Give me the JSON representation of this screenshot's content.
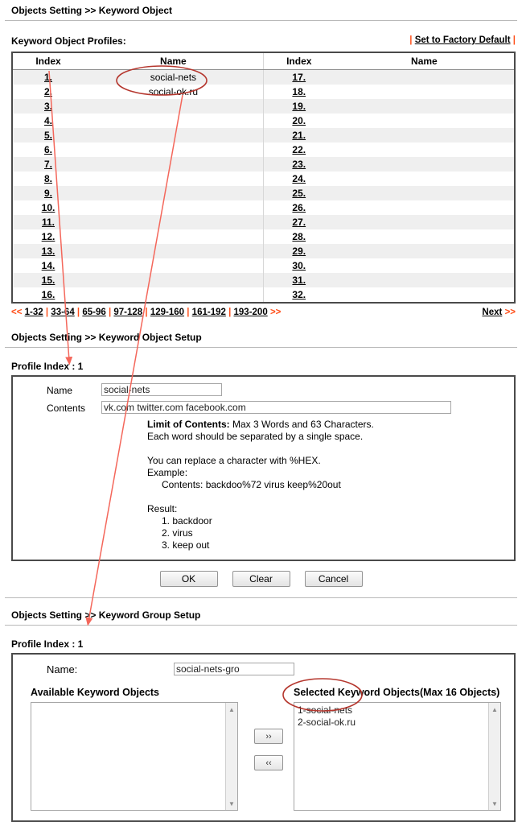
{
  "sections": {
    "keyword_object": {
      "title": "Objects Setting >> Keyword Object",
      "profiles_label": "Keyword Object Profiles:",
      "factory_default": "Set to Factory Default",
      "pipe": "|",
      "columns": [
        "Index",
        "Name",
        "Index",
        "Name"
      ],
      "rows_left": [
        {
          "index": "1.",
          "name": "social-nets"
        },
        {
          "index": "2.",
          "name": "social-ok.ru"
        },
        {
          "index": "3.",
          "name": ""
        },
        {
          "index": "4.",
          "name": ""
        },
        {
          "index": "5.",
          "name": ""
        },
        {
          "index": "6.",
          "name": ""
        },
        {
          "index": "7.",
          "name": ""
        },
        {
          "index": "8.",
          "name": ""
        },
        {
          "index": "9.",
          "name": ""
        },
        {
          "index": "10.",
          "name": ""
        },
        {
          "index": "11.",
          "name": ""
        },
        {
          "index": "12.",
          "name": ""
        },
        {
          "index": "13.",
          "name": ""
        },
        {
          "index": "14.",
          "name": ""
        },
        {
          "index": "15.",
          "name": ""
        },
        {
          "index": "16.",
          "name": ""
        }
      ],
      "rows_right": [
        {
          "index": "17.",
          "name": ""
        },
        {
          "index": "18.",
          "name": ""
        },
        {
          "index": "19.",
          "name": ""
        },
        {
          "index": "20.",
          "name": ""
        },
        {
          "index": "21.",
          "name": ""
        },
        {
          "index": "22.",
          "name": ""
        },
        {
          "index": "23.",
          "name": ""
        },
        {
          "index": "24.",
          "name": ""
        },
        {
          "index": "25.",
          "name": ""
        },
        {
          "index": "26.",
          "name": ""
        },
        {
          "index": "27.",
          "name": ""
        },
        {
          "index": "28.",
          "name": ""
        },
        {
          "index": "29.",
          "name": ""
        },
        {
          "index": "30.",
          "name": ""
        },
        {
          "index": "31.",
          "name": ""
        },
        {
          "index": "32.",
          "name": ""
        }
      ],
      "pager": {
        "prev_arrows": "<<",
        "next_arrows": ">>",
        "ranges": [
          "1-32",
          "33-64",
          "65-96",
          "97-128",
          "129-160",
          "161-192",
          "193-200"
        ],
        "separator": "|",
        "next_label": "Next",
        "next_label_arrows": ">>"
      }
    },
    "keyword_object_setup": {
      "title": "Objects Setting >> Keyword Object Setup",
      "profile_index": "Profile Index : 1",
      "name_label": "Name",
      "name_value": "social-nets",
      "contents_label": "Contents",
      "contents_value": "vk.com twitter.com facebook.com",
      "help": {
        "limit_bold": "Limit of Contents:",
        "limit_rest": " Max 3 Words and 63 Characters.",
        "line2": "Each word should be separated by a single space.",
        "line3": "You can replace a character with %HEX.",
        "line4": "Example:",
        "line5": "Contents: backdoo%72 virus keep%20out",
        "line6": "Result:",
        "line7": "1. backdoor",
        "line8": "2. virus",
        "line9": "3. keep out"
      },
      "buttons": {
        "ok": "OK",
        "clear": "Clear",
        "cancel": "Cancel"
      }
    },
    "keyword_group_setup": {
      "title": "Objects Setting >> Keyword Group Setup",
      "profile_index": "Profile Index : 1",
      "name_label": "Name:",
      "name_value": "social-nets-gro",
      "available_label": "Available Keyword Objects",
      "selected_label": "Selected Keyword Objects(Max 16 Objects)",
      "available_items": [],
      "selected_items": [
        "1-social-nets",
        "2-social-ok.ru"
      ],
      "move_right": "››",
      "move_left": "‹‹"
    }
  },
  "annotations": {
    "highlight_color": "#c0392b",
    "arrow_color": "#f4675b",
    "ellipse_top_target": "social-nets / social-ok.ru names in profile table",
    "ellipse_bottom_target": "1-social-nets / 2-social-ok.ru selected objects"
  },
  "colors": {
    "accent_orange": "#ff4f1a",
    "row_alt": "#efefef",
    "border_dark": "#4a4a4a"
  }
}
